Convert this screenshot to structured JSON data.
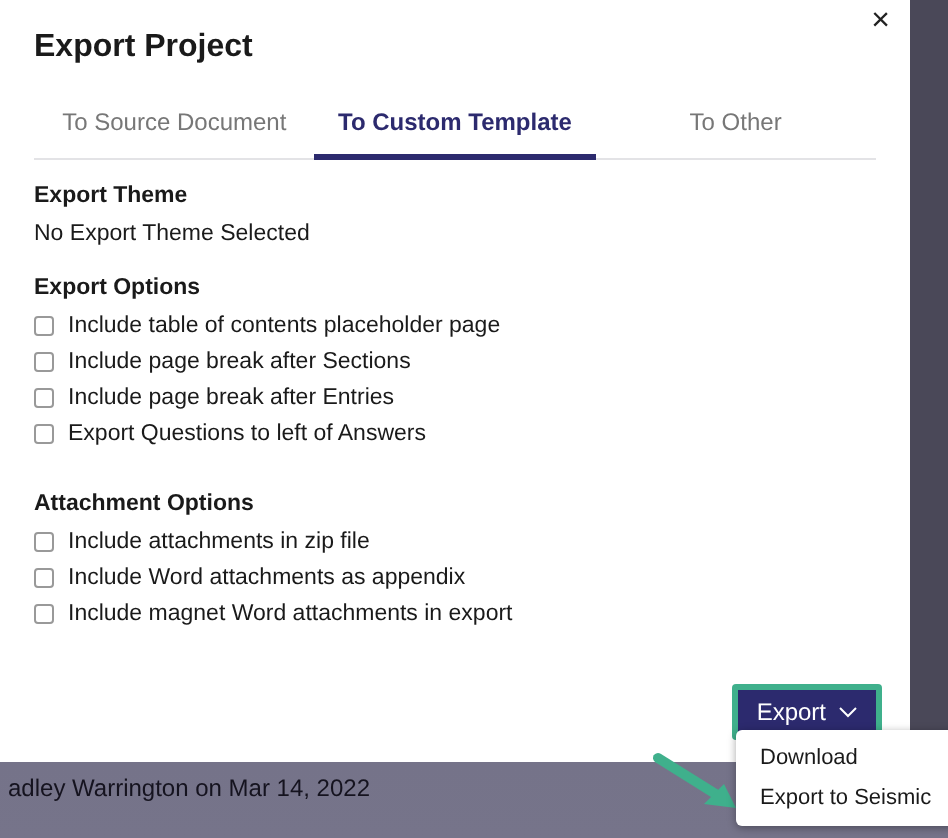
{
  "dialog": {
    "title": "Export Project",
    "close": "×"
  },
  "tabs": [
    {
      "label": "To Source Document",
      "selected": false
    },
    {
      "label": "To Custom Template",
      "selected": true
    },
    {
      "label": "To Other",
      "selected": false
    }
  ],
  "export_theme": {
    "heading": "Export Theme",
    "value": "No Export Theme Selected"
  },
  "sections": [
    {
      "heading": "Export Options",
      "options": [
        {
          "label": "Include table of contents placeholder page",
          "checked": false
        },
        {
          "label": "Include page break after Sections",
          "checked": false
        },
        {
          "label": "Include page break after Entries",
          "checked": false
        },
        {
          "label": "Export Questions to left of Answers",
          "checked": false
        }
      ]
    },
    {
      "heading": "Attachment Options",
      "options": [
        {
          "label": "Include attachments in zip file",
          "checked": false
        },
        {
          "label": "Include Word attachments as appendix",
          "checked": false
        },
        {
          "label": "Include magnet Word attachments in export",
          "checked": false
        }
      ]
    }
  ],
  "export_button": {
    "label": "Export",
    "highlighted": true
  },
  "export_menu": {
    "items": [
      "Download",
      "Export to Seismic"
    ]
  },
  "background": {
    "caption": "adley Warrington on Mar 14, 2022"
  }
}
